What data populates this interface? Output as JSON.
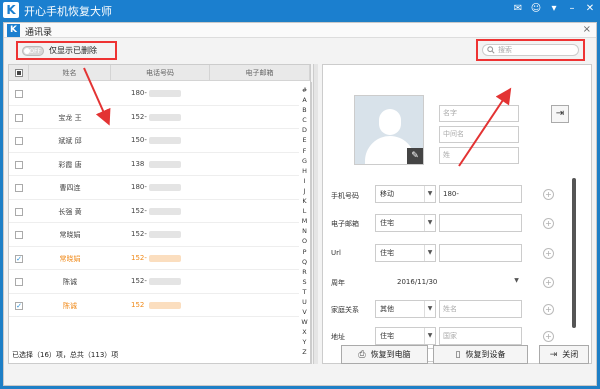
{
  "app": {
    "title": "开心手机恢复大师",
    "logo": "K",
    "controls": [
      {
        "name": "wechat-icon",
        "glyph": "✉"
      },
      {
        "name": "chat-icon",
        "glyph": "☺"
      },
      {
        "name": "menu-icon",
        "glyph": "▾"
      },
      {
        "name": "minimize-icon",
        "glyph": "–"
      },
      {
        "name": "close-icon",
        "glyph": "✕"
      }
    ]
  },
  "dialog": {
    "title": "通讯录",
    "close_glyph": "×",
    "toggle_state": "OFF",
    "toggle_label": "仅显示已删除",
    "search_placeholder": "搜索",
    "accent_color": "#e33333"
  },
  "table": {
    "columns": [
      "姓名",
      "电话号码",
      "电子邮箱"
    ],
    "rows": [
      {
        "name": "",
        "phone": "180-",
        "checked": false
      },
      {
        "name": "宝龙 王",
        "phone": "152-",
        "checked": false
      },
      {
        "name": "斌斌 邱",
        "phone": "150-",
        "checked": false
      },
      {
        "name": "彩霞 唐",
        "phone": "138",
        "checked": false
      },
      {
        "name": "曹四连",
        "phone": "180-",
        "checked": false
      },
      {
        "name": "长强 黄",
        "phone": "152-",
        "checked": false
      },
      {
        "name": "常晓娟",
        "phone": "152-",
        "checked": false
      },
      {
        "name": "常晓娟",
        "phone": "152-",
        "checked": true
      },
      {
        "name": "陈诚",
        "phone": "152-",
        "checked": false
      },
      {
        "name": "陈诚",
        "phone": "152",
        "checked": true
      }
    ],
    "alphabet": [
      "#",
      "A",
      "B",
      "C",
      "D",
      "E",
      "F",
      "G",
      "H",
      "I",
      "J",
      "K",
      "L",
      "M",
      "N",
      "O",
      "P",
      "Q",
      "R",
      "S",
      "T",
      "U",
      "V",
      "W",
      "X",
      "Y",
      "Z"
    ]
  },
  "detail": {
    "name_placeholders": {
      "first": "名字",
      "middle": "中间名",
      "last": "姓"
    },
    "phone": {
      "label": "手机号码",
      "type": "移动",
      "value": "180-"
    },
    "email": {
      "label": "电子邮箱",
      "type": "住宅"
    },
    "url": {
      "label": "Url",
      "type": "住宅"
    },
    "anniversary": {
      "label": "周年",
      "value": "2016/11/30"
    },
    "family": {
      "label": "家庭关系",
      "type": "其他",
      "placeholder": "姓名"
    },
    "address": {
      "label": "地址",
      "type": "住宅",
      "country_placeholder": "国家",
      "province_placeholder": "省",
      "city_placeholder": "市"
    }
  },
  "footer": {
    "status": "已选择（16）项，总共（113）项",
    "restore_pc": "恢复到电脑",
    "restore_device": "恢复到设备",
    "close": "关闭"
  }
}
